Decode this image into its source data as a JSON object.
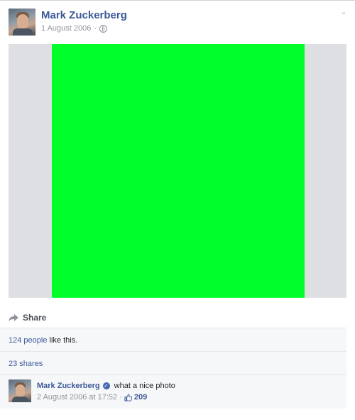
{
  "post": {
    "author": "Mark Zuckerberg",
    "date": "1 August 2006",
    "separator": "·",
    "photo_color": "#00ff2a"
  },
  "actions": {
    "share_label": "Share"
  },
  "stats": {
    "likes_link": "124 people",
    "likes_suffix": " like this.",
    "shares": "23 shares"
  },
  "comment": {
    "author": "Mark Zuckerberg",
    "text": "what a nice photo",
    "timestamp": "2 August 2006 at 17:52",
    "separator": "·",
    "like_count": "209"
  },
  "colors": {
    "link": "#3b5998",
    "meta": "#90949c",
    "photo_background": "#dddfe2"
  }
}
